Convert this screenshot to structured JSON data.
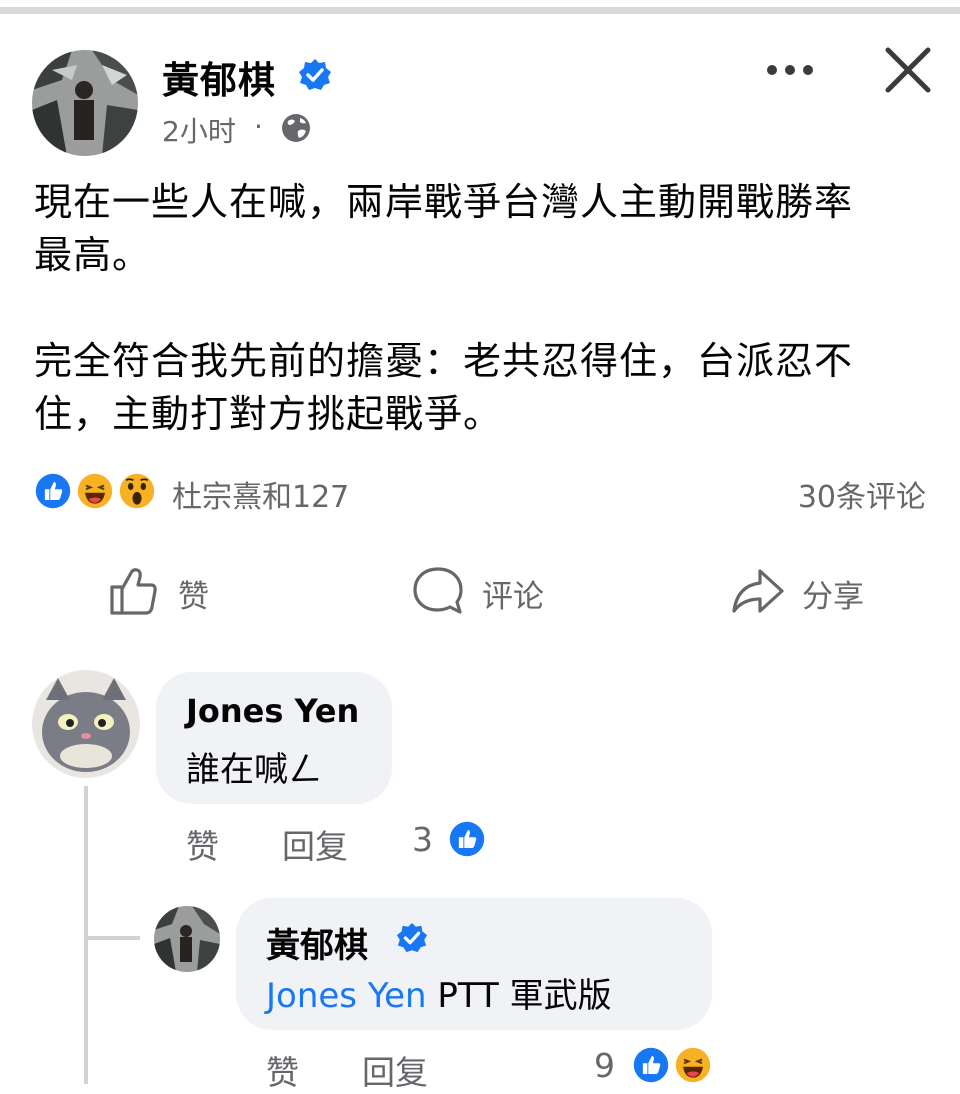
{
  "post": {
    "author": "黃郁棋",
    "time": "2小时",
    "separator": "·",
    "text": "現在一些人在喊，兩岸戰爭台灣人主動開戰勝率\n最高。\n\n完全符合我先前的擔憂：老共忍得住，台派忍不\n住，主動打對方挑起戰爭。",
    "reactors": "杜宗熹和127",
    "comment_count": "30条评论"
  },
  "actions": {
    "like": "赞",
    "comment": "评论",
    "share": "分享"
  },
  "comments": [
    {
      "author": "Jones Yen",
      "text": "誰在喊ㄥ",
      "like_label": "赞",
      "reply_label": "回复",
      "reaction_count": "3"
    },
    {
      "author": "黃郁棋",
      "mention": "Jones Yen",
      "text": " PTT 軍武版",
      "like_label": "赞",
      "reply_label": "回复",
      "reaction_count": "9"
    }
  ],
  "colors": {
    "accent": "#1877f2",
    "secondary_text": "#65676b",
    "bubble": "#f0f2f5",
    "haha": "#f7b125"
  },
  "icons": [
    "verified-badge-icon",
    "globe-icon",
    "more-icon",
    "close-icon",
    "like-reaction-icon",
    "haha-reaction-icon",
    "wow-reaction-icon",
    "thumbs-up-icon",
    "comment-bubble-icon",
    "share-arrow-icon"
  ]
}
